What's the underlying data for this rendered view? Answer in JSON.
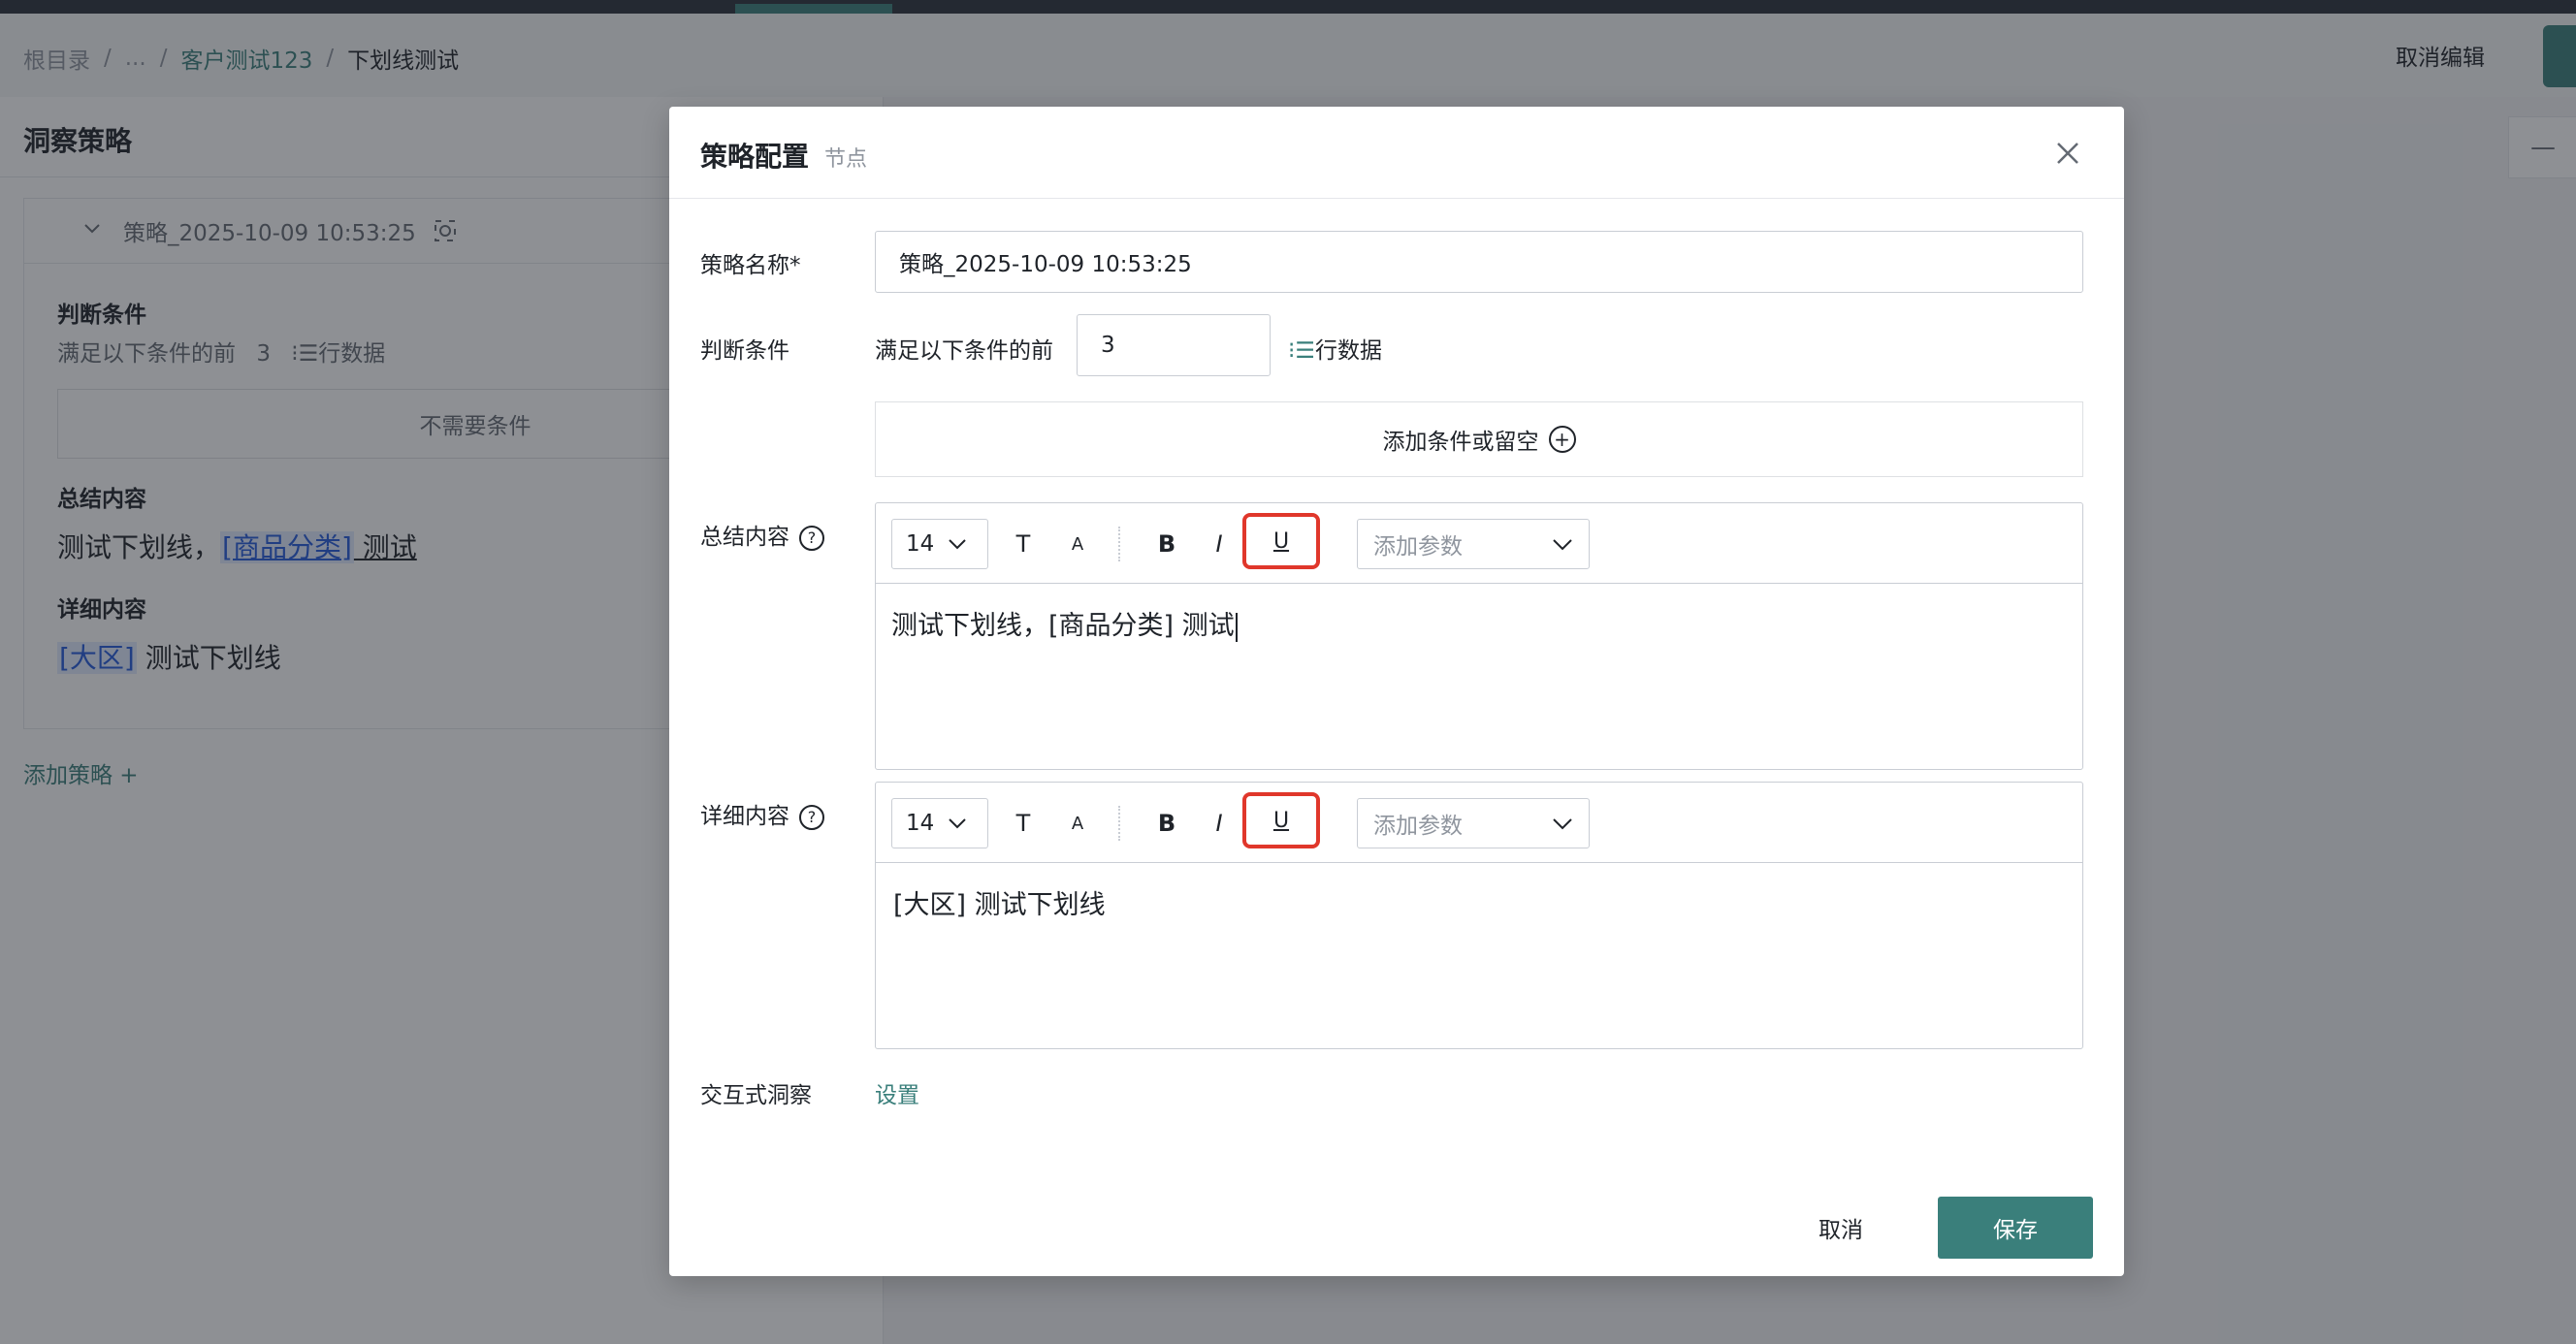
{
  "breadcrumb": [
    "根目录",
    "...",
    "客户测试123",
    "下划线测试"
  ],
  "header": {
    "cancel_edit": "取消编辑"
  },
  "left_panel": {
    "title": "洞察策略",
    "strategy_name": "策略_2025-10-09 10:53:25",
    "condition_label": "判断条件",
    "condition_prefix": "满足以下条件的前",
    "condition_rows": "3",
    "condition_suffix": "行数据",
    "no_condition": "不需要条件",
    "summary_label": "总结内容",
    "summary_text": "测试下划线，",
    "summary_tag": "[商品分类]",
    "summary_after": " 测试",
    "detail_label": "详细内容",
    "detail_tag": "[大区]",
    "detail_text": " 测试下划线",
    "add_strategy": "添加策略"
  },
  "modal": {
    "title": "策略配置",
    "subtitle": "节点",
    "name_label": "策略名称*",
    "name_value": "策略_2025-10-09 10:53:25",
    "condition_label": "判断条件",
    "condition_prefix": "满足以下条件的前",
    "condition_rows": "3",
    "condition_suffix": "行数据",
    "add_condition": "添加条件或留空",
    "summary": {
      "label": "总结内容",
      "font_size": "14",
      "param_placeholder": "添加参数",
      "content": "测试下划线，[商品分类] 测试"
    },
    "detail": {
      "label": "详细内容",
      "font_size": "14",
      "param_placeholder": "添加参数",
      "content": "[大区] 测试下划线"
    },
    "interactive_label": "交互式洞察",
    "interactive_link": "设置",
    "cancel": "取消",
    "save": "保存"
  },
  "toolbar_buttons": {
    "text_size": "T",
    "text_color": "A",
    "bold": "B",
    "italic": "I",
    "underline": "U"
  },
  "colors": {
    "accent": "#3a7f7b",
    "highlight": "#e0372b",
    "tag_bg": "#e1eaff",
    "tag_fg": "#245bdb"
  }
}
